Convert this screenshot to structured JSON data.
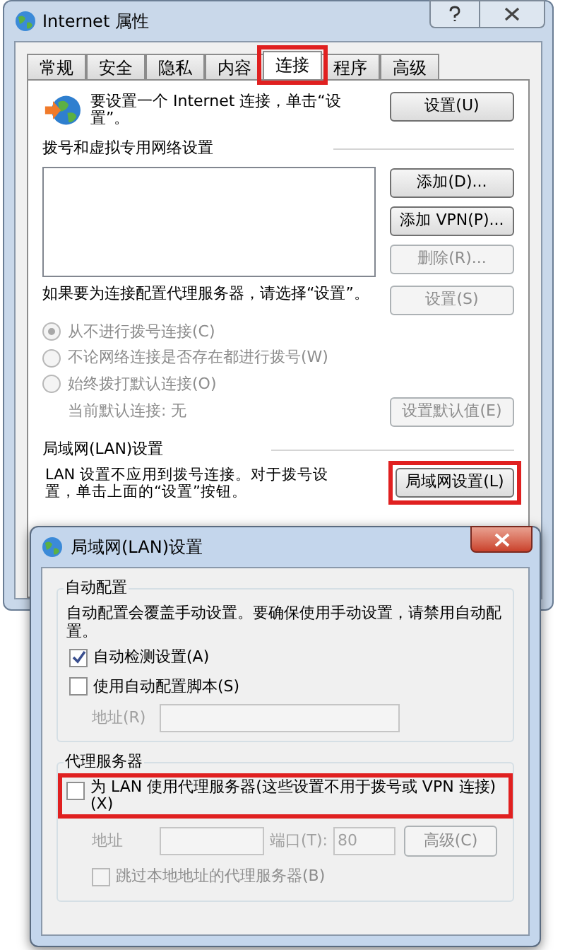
{
  "window": {
    "title": "Internet 属性"
  },
  "tabs": [
    {
      "label": "常规",
      "selected": false,
      "highlighted": false
    },
    {
      "label": "安全",
      "selected": false,
      "highlighted": false
    },
    {
      "label": "隐私",
      "selected": false,
      "highlighted": false
    },
    {
      "label": "内容",
      "selected": false,
      "highlighted": false
    },
    {
      "label": "连接",
      "selected": true,
      "highlighted": true
    },
    {
      "label": "程序",
      "selected": false,
      "highlighted": false
    },
    {
      "label": "高级",
      "selected": false,
      "highlighted": false
    }
  ],
  "setup": {
    "text": "要设置一个 Internet 连接，单击“设置”。",
    "button": {
      "label": "设置(U)",
      "disabled": false
    }
  },
  "dialup": {
    "heading": "拨号和虚拟专用网络设置",
    "buttons": [
      {
        "label": "添加(D)...",
        "disabled": false
      },
      {
        "label": "添加 VPN(P)...",
        "disabled": false
      },
      {
        "label": "删除(R)...",
        "disabled": true
      }
    ],
    "proxy_text": "如果要为连接配置代理服务器，请选择“设置”。",
    "proxy_button": {
      "label": "设置(S)",
      "disabled": true
    },
    "options": [
      {
        "label": "从不进行拨号连接(C)",
        "selected": true,
        "disabled": true
      },
      {
        "label": "不论网络连接是否存在都进行拨号(W)",
        "selected": false,
        "disabled": true
      },
      {
        "label": "始终拨打默认连接(O)",
        "selected": false,
        "disabled": true
      }
    ],
    "current_default": "当前默认连接: 无",
    "default_button": {
      "label": "设置默认值(E)",
      "disabled": true
    }
  },
  "lan": {
    "heading": "局域网(LAN)设置",
    "text": "LAN 设置不应用到拨号连接。对于拨号设置，单击上面的“设置”按钮。",
    "button": {
      "label": "局域网设置(L)",
      "disabled": false,
      "highlighted": true
    }
  },
  "lan_dialog": {
    "title": "局域网(LAN)设置",
    "auto": {
      "heading": "自动配置",
      "text": "自动配置会覆盖手动设置。要确保使用手动设置，请禁用自动配置。",
      "options": [
        {
          "label": "自动检测设置(A)",
          "checked": true,
          "disabled": false
        },
        {
          "label": "使用自动配置脚本(S)",
          "checked": false,
          "disabled": false
        }
      ],
      "address": {
        "label": "地址(R)",
        "disabled": true
      }
    },
    "proxy": {
      "heading": "代理服务器",
      "option": {
        "label": "为 LAN 使用代理服务器(这些设置不用于拨号或 VPN 连接)(X)",
        "checked": false,
        "highlighted": true
      },
      "disabled": true,
      "address_label": "地址",
      "port_label": "端口(T):",
      "port_value": "80",
      "advanced_button": "高级(C)",
      "bypass": {
        "label": "跳过本地地址的代理服务器(B)",
        "checked": false
      }
    }
  }
}
